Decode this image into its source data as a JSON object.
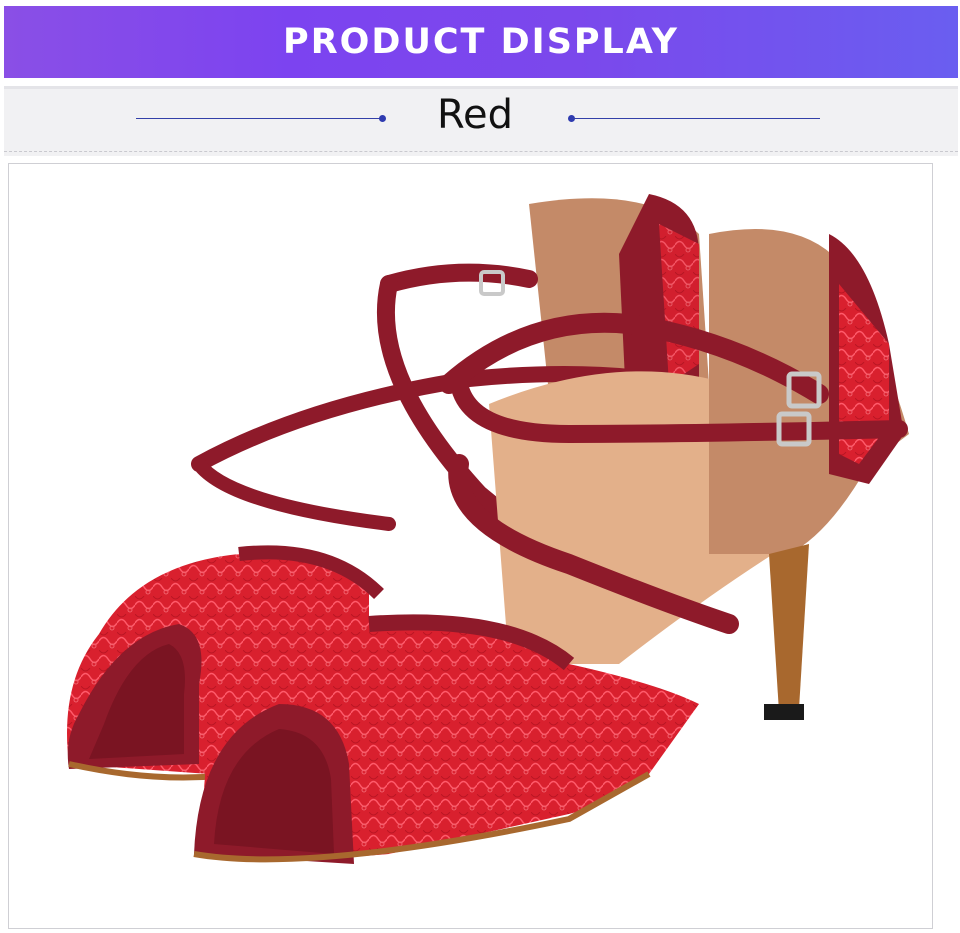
{
  "banner": {
    "title": "PRODUCT DISPLAY",
    "gradient_start": "#8a4fe6",
    "gradient_end": "#6a5ef0"
  },
  "variant": {
    "label": "Red",
    "rule_color": "#3340a8"
  },
  "product_image": {
    "subject": "red-lace-dance-sandals",
    "colors": {
      "suede": "#8e1a2a",
      "lace": "#d9202e",
      "lining": "#c48a68",
      "insole": "#e3b08a",
      "buckle": "#c9c9c9",
      "heel": "#a8682e"
    }
  }
}
